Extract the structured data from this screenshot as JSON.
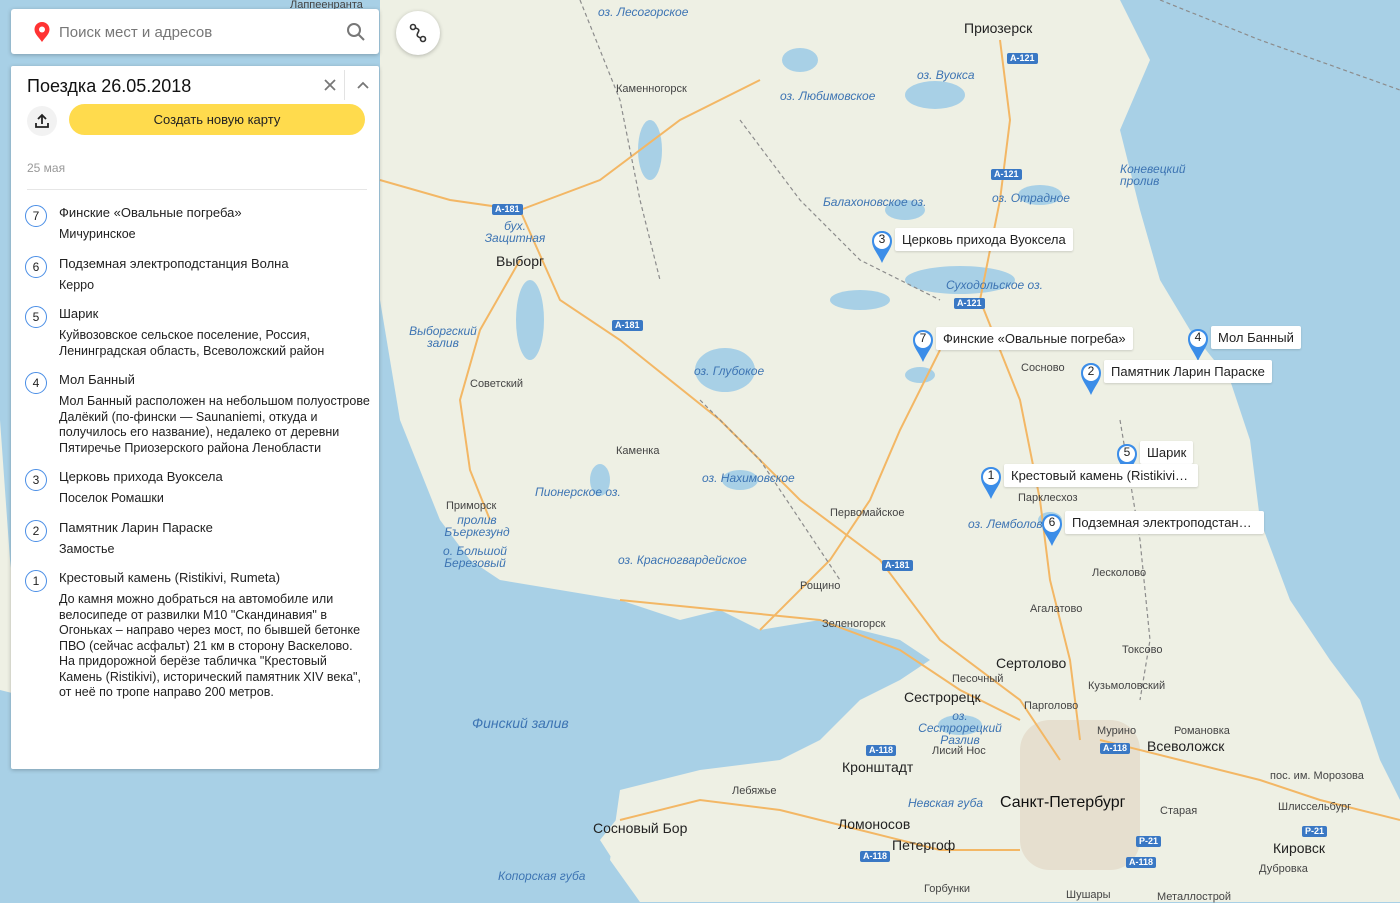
{
  "search": {
    "placeholder": "Поиск мест и адресов"
  },
  "panel": {
    "title": "Поездка 26.05.2018",
    "create_button": "Создать новую карту",
    "date": "25 мая",
    "items": [
      {
        "num": "7",
        "name": "Финские «Овальные погреба»",
        "desc": "Мичуринское"
      },
      {
        "num": "6",
        "name": "Подземная электроподстанция Волна",
        "desc": "Керро"
      },
      {
        "num": "5",
        "name": "Шарик",
        "desc": "Куйвозовское сельское поселение, Россия, Ленинградская область, Всеволожский район"
      },
      {
        "num": "4",
        "name": "Мол Банный",
        "desc": "Мол Банный расположен на небольшом полуострове Далёкий (по-фински — Saunaniemi, откуда и получилось его название), недалеко от деревни Пятиречье Приозерского района Ленобласти"
      },
      {
        "num": "3",
        "name": "Церковь прихода Вуоксела",
        "desc": "Поселок Ромашки"
      },
      {
        "num": "2",
        "name": "Памятник Ларин Параске",
        "desc": "Замостье"
      },
      {
        "num": "1",
        "name": "Крестовый камень (Ristikivi, Rumeta)",
        "desc": "До камня можно добраться на автомобиле или велосипеде от развилки М10 \"Скандинавия\" в Огоньках – направо через мост, по бывшей бетонке ПВО (сейчас асфальт) 21 км в сторону Васкелово. На придорожной берёзе табличка \"Крестовый Камень (Ristikivi), исторический памятник XIV века\", от неё по тропе направо 200 метров."
      }
    ]
  },
  "markers": [
    {
      "num": "3",
      "label": "Церковь прихода Вуоксела"
    },
    {
      "num": "7",
      "label": "Финские «Овальные погреба»"
    },
    {
      "num": "4",
      "label": "Мол Банный"
    },
    {
      "num": "2",
      "label": "Памятник Ларин Параске"
    },
    {
      "num": "5",
      "label": "Шарик"
    },
    {
      "num": "1",
      "label": "Крестовый камень (Ristikivi, …"
    },
    {
      "num": "6",
      "label": "Подземная электроподстанц…"
    }
  ],
  "map_labels": {
    "priozersk": "Приозерск",
    "kamennogorsk": "Каменногорск",
    "vyborg": "Выборг",
    "sovetsky": "Советский",
    "kamenka": "Каменка",
    "primorsk": "Приморск",
    "pervomayskoe": "Первомайское",
    "roshchino": "Рощино",
    "zelenogorsk": "Зеленогорск",
    "sestroretsk": "Сестрорецк",
    "sertolovo": "Сертолово",
    "pesochny": "Песочный",
    "spb": "Санкт-Петербург",
    "vsevolozhsk": "Всеволожск",
    "kronshtadt": "Кронштадт",
    "lomonosov": "Ломоносов",
    "peterhof": "Петергоф",
    "sosnovy_bor": "Сосновый Бор",
    "kirovsk": "Кировск",
    "sosnovo": "Сосново",
    "lesnolovo": "Лесколово",
    "agalatovo": "Агалатово",
    "toksovo": "Токсово",
    "kuzmolovsky": "Кузьмоловский",
    "pargolovo": "Парголово",
    "murino": "Мурино",
    "romanovka": "Романовка",
    "morozova": "пос. им. Морозова",
    "shlisselburg": "Шлиссельбург",
    "staraya": "Старая",
    "dubrovka": "Дубровка",
    "lisiy_nos": "Лисий Нос",
    "lebyazhye": "Лебяжье",
    "gorbunki": "Горбунки",
    "shushary": "Шушары",
    "metallostroy": "Металлострой",
    "lappeenranta": "Лаппеенранта",
    "parklesoz": "Парклесхоз",
    "lake_lesogorskoe": "оз. Лесогорское",
    "lake_vuoksa": "оз. Вуокса",
    "lake_lyubimovskoe": "оз. Любимовское",
    "lake_balakhonovskoe": "Балахоновское оз.",
    "lake_otradnoe": "оз. Отрадное",
    "lake_sukhodolskoe": "Суходольское оз.",
    "lake_glubokoe": "оз. Глубокое",
    "lake_nakhimovskoe": "оз. Нахимовское",
    "lake_pionerskoe": "Пионерское оз.",
    "lake_krasnogvardeyskoe": "оз. Красногвардейское",
    "lake_lembolovo": "оз. Лемболово",
    "lake_sestroretsky": "оз. Сестрорецкий Разлив",
    "bay_zashchitnaya": "бух. Защитная",
    "bay_vyborgsky": "Выборгский залив",
    "strait_berezund": "пролив Бъеркезунд",
    "island_berezovy": "о. Большой Березовый",
    "strait_konevetsky": "Коневецкий пролив",
    "gulf_finland": "Финский залив",
    "neva_bay": "Невская губа",
    "koporskaya": "Копорская губа",
    "road_a121": "А-121",
    "road_a181": "А-181",
    "road_a118": "А-118",
    "road_r21": "Р-21"
  },
  "colors": {
    "water": "#a8d0e6",
    "land": "#eef0e4",
    "accent": "#ffdb4d",
    "marker": "#3b8de8"
  }
}
